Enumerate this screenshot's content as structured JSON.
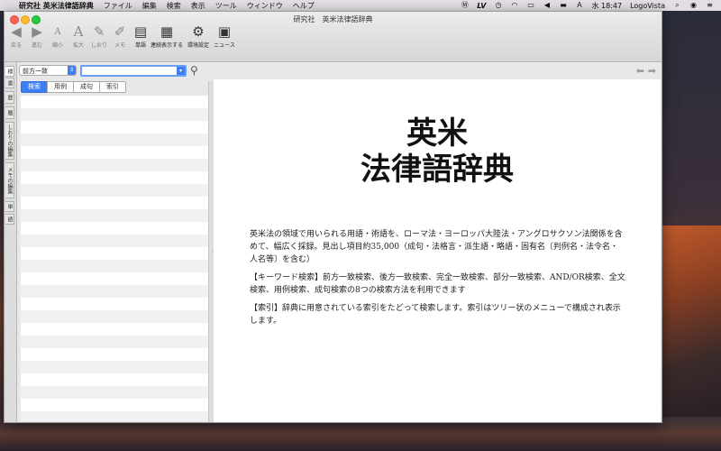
{
  "menubar": {
    "app_name": "研究社 英米法律語辞典",
    "menus": [
      "ファイル",
      "編集",
      "検索",
      "表示",
      "ツール",
      "ウィンドウ",
      "ヘルプ"
    ],
    "status": {
      "lv": "LV",
      "clock": "水 18:47",
      "app_label": "LogoVista"
    }
  },
  "window": {
    "title": "研究社　英米法律語辞典",
    "toolbar": [
      {
        "label": "戻る",
        "icon": "back-arrow-icon"
      },
      {
        "label": "進む",
        "icon": "forward-arrow-icon"
      },
      {
        "label": "縮小",
        "icon": "font-smaller-icon"
      },
      {
        "label": "拡大",
        "icon": "font-larger-icon"
      },
      {
        "label": "しおり",
        "icon": "bookmark-icon"
      },
      {
        "label": "メモ",
        "icon": "memo-icon"
      },
      {
        "label": "単語",
        "icon": "word-book-icon"
      },
      {
        "label": "連続表示する",
        "icon": "continuous-display-icon"
      },
      {
        "label": "環境設定",
        "icon": "gear-icon"
      },
      {
        "label": "ニュース",
        "icon": "news-icon"
      }
    ]
  },
  "vtabs": [
    "検",
    "書",
    "歴",
    "履",
    "しおりの編集",
    "メモの編集",
    "単",
    "語"
  ],
  "search": {
    "mode": "前方一致",
    "query": ""
  },
  "segments": [
    "検索",
    "用例",
    "成句",
    "索引"
  ],
  "active_segment": "検索",
  "content": {
    "title_line1": "英米",
    "title_line2": "法律語辞典",
    "para1": "英米法の領域で用いられる用語・術語を、ローマ法・ヨーロッパ大陸法・アングロサクソン法関係を含めて、幅広く採録。見出し項目約35,000（成句・法格言・派生語・略語・固有名〔判例名・法令名・人名等〕を含む）",
    "para2": "【キーワード検索】前方一致検索、後方一致検索、完全一致検索、部分一致検索、AND/OR検索、全文検索、用例検索、成句検索の8つの検索方法を利用できます",
    "para3": "【索引】辞典に用意されている索引をたどって検索します。索引はツリー状のメニューで構成され表示します。"
  }
}
